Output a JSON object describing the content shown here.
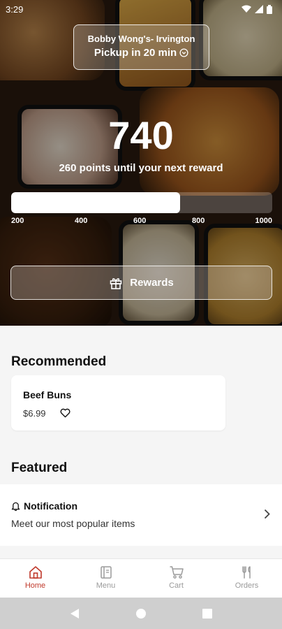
{
  "status_bar": {
    "time": "3:29"
  },
  "pickup": {
    "store": "Bobby Wong's- Irvington",
    "time": "Pickup in 20 min"
  },
  "rewards": {
    "points": "740",
    "subtitle": "260 points until your next reward",
    "progress_fraction": 0.648,
    "ticks": [
      "200",
      "400",
      "600",
      "800",
      "1000"
    ],
    "button_label": "Rewards"
  },
  "recommended": {
    "title": "Recommended",
    "items": [
      {
        "name": "Beef Buns",
        "price": "$6.99"
      }
    ]
  },
  "featured": {
    "title": "Featured",
    "notification": {
      "title": "Notification",
      "subtitle": "Meet our most popular items"
    }
  },
  "bottom_nav": {
    "items": [
      {
        "label": "Home",
        "icon": "home-icon",
        "active": true
      },
      {
        "label": "Menu",
        "icon": "menu-icon",
        "active": false
      },
      {
        "label": "Cart",
        "icon": "cart-icon",
        "active": false
      },
      {
        "label": "Orders",
        "icon": "orders-icon",
        "active": false
      }
    ]
  },
  "colors": {
    "accent": "#c0392b",
    "inactive": "#9a9a9a",
    "background": "#f5f5f5"
  }
}
